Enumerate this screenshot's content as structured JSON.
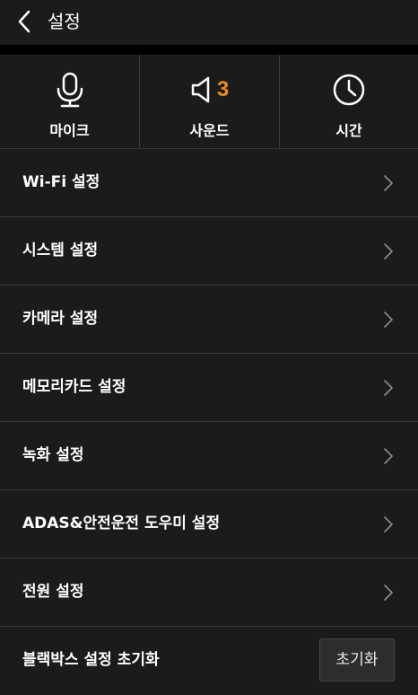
{
  "header": {
    "title": "설정",
    "back_icon": "chevron-left-icon"
  },
  "quick": [
    {
      "label": "마이크",
      "icon": "microphone-icon"
    },
    {
      "label": "사운드",
      "icon": "speaker-icon",
      "value": "3"
    },
    {
      "label": "시간",
      "icon": "clock-icon"
    }
  ],
  "menu": [
    {
      "label": "Wi-Fi 설정"
    },
    {
      "label": "시스템 설정"
    },
    {
      "label": "카메라 설정"
    },
    {
      "label": "메모리카드 설정"
    },
    {
      "label": "녹화 설정"
    },
    {
      "label": "ADAS&안전운전 도우미 설정"
    },
    {
      "label": "전원 설정"
    }
  ],
  "reset": {
    "label": "블랙박스 설정 초기화",
    "button_label": "초기화"
  },
  "colors": {
    "background": "#1b1b1b",
    "divider": "#3a3a3a",
    "accent": "#e98a23"
  }
}
